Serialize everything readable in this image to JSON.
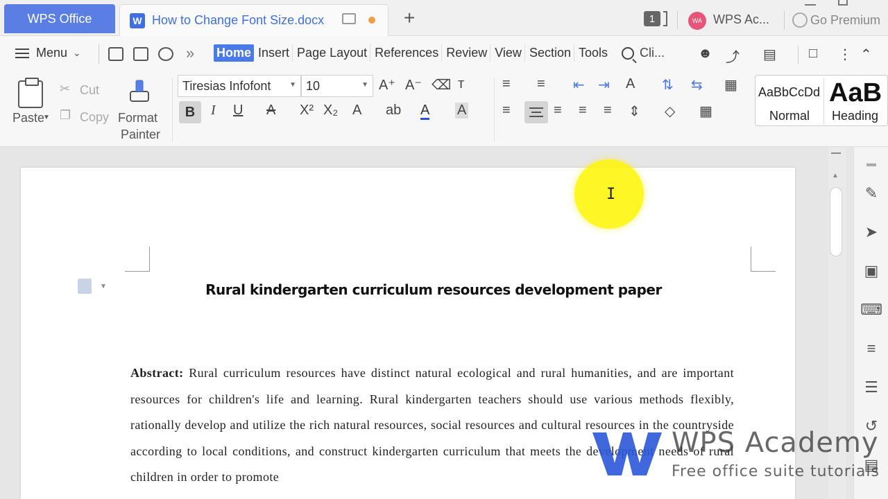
{
  "titlebar": {
    "app_tab": "WPS Office",
    "doc_tab": "How to Change Font Size.docx",
    "window_count": "1",
    "user_initials": "WA",
    "user_name": "WPS Ac...",
    "premium": "Go Premium",
    "accent_color": "#5b7ee5"
  },
  "menubar": {
    "menu_label": "Menu",
    "tabs": [
      "Home",
      "Insert",
      "Page Layout",
      "References",
      "Review",
      "View",
      "Section",
      "Tools"
    ],
    "active_tab": "Home",
    "search_label": "Cli...",
    "overflow": "»"
  },
  "ribbon": {
    "paste": "Paste",
    "cut": "Cut",
    "copy": "Copy",
    "format_painter_1": "Format",
    "format_painter_2": "Painter",
    "font_name": "Tiresias Infofont",
    "font_size": "10",
    "styles": {
      "normal_sample": "AaBbCcDd",
      "normal_label": "Normal",
      "heading_sample": "AaB",
      "heading_label": "Heading"
    }
  },
  "document": {
    "title": "Rural kindergarten curriculum resources development paper",
    "abstract_label": "Abstract:",
    "abstract_text": " Rural curriculum resources have distinct natural ecological and rural humanities, and are important resources for children's life and learning. Rural kindergarten teachers should use various methods flexibly, rationally develop and utilize the rich natural resources, social resources and cultural resources in the countryside according to local conditions, and construct kindergarten curriculum that meets the development needs of rural children in order to promote"
  },
  "watermark": {
    "title": "WPS Academy",
    "subtitle": "Free office suite tutorials"
  }
}
